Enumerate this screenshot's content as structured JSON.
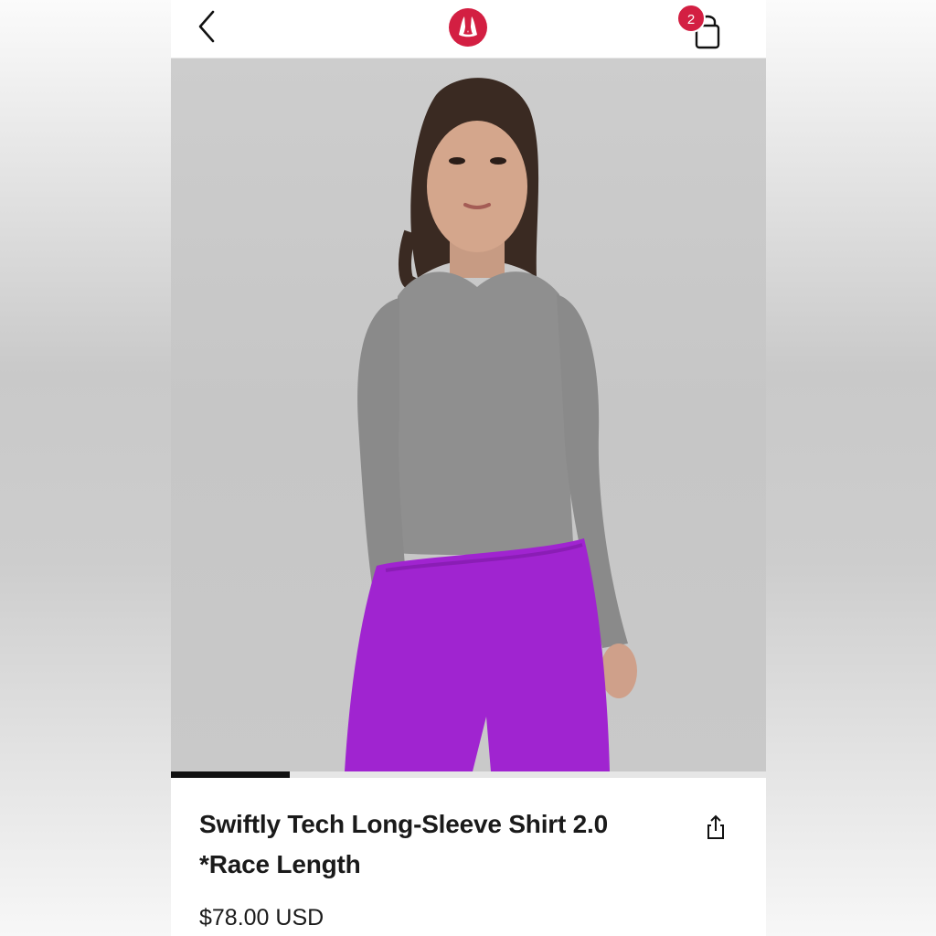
{
  "header": {
    "back_icon": "chevron-left-icon",
    "logo_icon": "lululemon-logo",
    "cart_icon": "shopping-bag-icon",
    "cart_count": "2",
    "brand_color": "#d31f42"
  },
  "gallery": {
    "image_subject": "Model wearing heather grey long-sleeve shirt and purple pants",
    "progress": 0.2,
    "shirt_color": "#8f8f8f",
    "pants_color": "#a024d0"
  },
  "product": {
    "title_line1": "Swiftly Tech Long-Sleeve Shirt 2.0",
    "title_line2": "*Race Length",
    "price": "$78.00 USD",
    "share_icon": "share-icon"
  }
}
